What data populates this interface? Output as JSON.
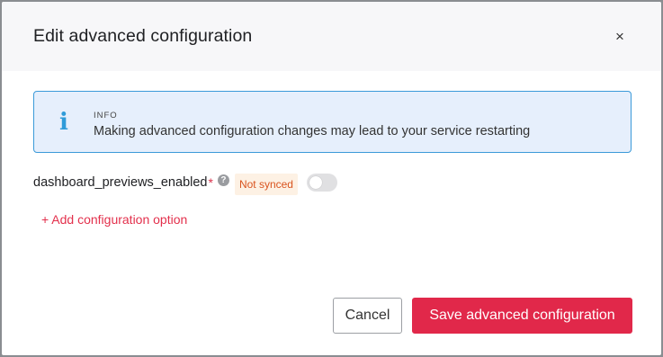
{
  "modal": {
    "title": "Edit advanced configuration",
    "close_label": "×"
  },
  "info": {
    "icon": "info-icon",
    "icon_glyph": "i",
    "label": "INFO",
    "message": "Making advanced configuration changes may lead to your service restarting"
  },
  "config_option": {
    "key": "dashboard_previews_enabled",
    "required_mark": "*",
    "help_icon": "help-icon",
    "help_glyph": "?",
    "badge": "Not synced",
    "toggle_on": false
  },
  "add_option": {
    "label": "+ Add configuration option"
  },
  "footer": {
    "cancel_label": "Cancel",
    "save_label": "Save advanced configuration"
  },
  "colors": {
    "accent": "#e1284a",
    "info_border": "#3b9ad9",
    "info_bg": "#e6effc",
    "badge_text": "#d9541f",
    "badge_bg": "#fdf1e4"
  }
}
